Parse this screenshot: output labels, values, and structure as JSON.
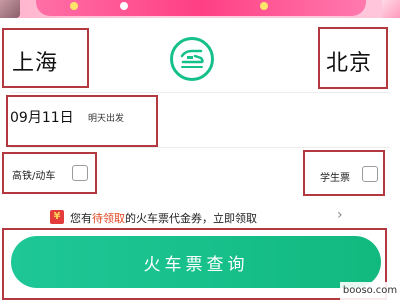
{
  "route": {
    "from_city": "上海",
    "to_city": "北京",
    "swap_icon": "train-swap-icon"
  },
  "date": {
    "value": "09月11日",
    "hint": "明天出发"
  },
  "options": {
    "gaotie_label": "高铁/动车",
    "student_label": "学生票"
  },
  "promo": {
    "prefix": "您有",
    "highlight": "待领取",
    "suffix": "的火车票代金券，立即领取",
    "arrow": "›"
  },
  "actions": {
    "search_label": "火车票查询"
  },
  "watermark": {
    "text": "booso.com"
  },
  "colors": {
    "accent": "#16c08a",
    "highlight": "#e2451f",
    "annotation": "#b3383f"
  }
}
